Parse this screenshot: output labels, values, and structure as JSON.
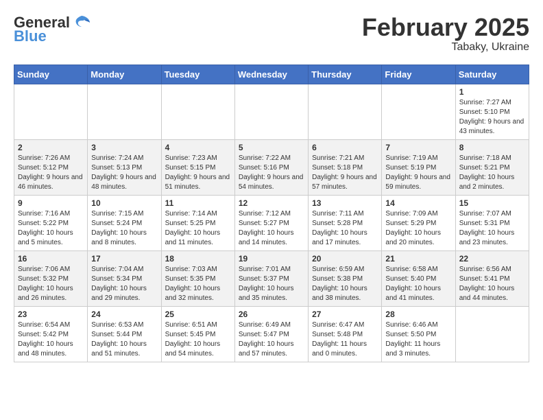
{
  "logo": {
    "general": "General",
    "blue": "Blue"
  },
  "title": "February 2025",
  "subtitle": "Tabaky, Ukraine",
  "days_of_week": [
    "Sunday",
    "Monday",
    "Tuesday",
    "Wednesday",
    "Thursday",
    "Friday",
    "Saturday"
  ],
  "weeks": [
    [
      {
        "day": "",
        "info": ""
      },
      {
        "day": "",
        "info": ""
      },
      {
        "day": "",
        "info": ""
      },
      {
        "day": "",
        "info": ""
      },
      {
        "day": "",
        "info": ""
      },
      {
        "day": "",
        "info": ""
      },
      {
        "day": "1",
        "info": "Sunrise: 7:27 AM\nSunset: 5:10 PM\nDaylight: 9 hours and 43 minutes."
      }
    ],
    [
      {
        "day": "2",
        "info": "Sunrise: 7:26 AM\nSunset: 5:12 PM\nDaylight: 9 hours and 46 minutes."
      },
      {
        "day": "3",
        "info": "Sunrise: 7:24 AM\nSunset: 5:13 PM\nDaylight: 9 hours and 48 minutes."
      },
      {
        "day": "4",
        "info": "Sunrise: 7:23 AM\nSunset: 5:15 PM\nDaylight: 9 hours and 51 minutes."
      },
      {
        "day": "5",
        "info": "Sunrise: 7:22 AM\nSunset: 5:16 PM\nDaylight: 9 hours and 54 minutes."
      },
      {
        "day": "6",
        "info": "Sunrise: 7:21 AM\nSunset: 5:18 PM\nDaylight: 9 hours and 57 minutes."
      },
      {
        "day": "7",
        "info": "Sunrise: 7:19 AM\nSunset: 5:19 PM\nDaylight: 9 hours and 59 minutes."
      },
      {
        "day": "8",
        "info": "Sunrise: 7:18 AM\nSunset: 5:21 PM\nDaylight: 10 hours and 2 minutes."
      }
    ],
    [
      {
        "day": "9",
        "info": "Sunrise: 7:16 AM\nSunset: 5:22 PM\nDaylight: 10 hours and 5 minutes."
      },
      {
        "day": "10",
        "info": "Sunrise: 7:15 AM\nSunset: 5:24 PM\nDaylight: 10 hours and 8 minutes."
      },
      {
        "day": "11",
        "info": "Sunrise: 7:14 AM\nSunset: 5:25 PM\nDaylight: 10 hours and 11 minutes."
      },
      {
        "day": "12",
        "info": "Sunrise: 7:12 AM\nSunset: 5:27 PM\nDaylight: 10 hours and 14 minutes."
      },
      {
        "day": "13",
        "info": "Sunrise: 7:11 AM\nSunset: 5:28 PM\nDaylight: 10 hours and 17 minutes."
      },
      {
        "day": "14",
        "info": "Sunrise: 7:09 AM\nSunset: 5:29 PM\nDaylight: 10 hours and 20 minutes."
      },
      {
        "day": "15",
        "info": "Sunrise: 7:07 AM\nSunset: 5:31 PM\nDaylight: 10 hours and 23 minutes."
      }
    ],
    [
      {
        "day": "16",
        "info": "Sunrise: 7:06 AM\nSunset: 5:32 PM\nDaylight: 10 hours and 26 minutes."
      },
      {
        "day": "17",
        "info": "Sunrise: 7:04 AM\nSunset: 5:34 PM\nDaylight: 10 hours and 29 minutes."
      },
      {
        "day": "18",
        "info": "Sunrise: 7:03 AM\nSunset: 5:35 PM\nDaylight: 10 hours and 32 minutes."
      },
      {
        "day": "19",
        "info": "Sunrise: 7:01 AM\nSunset: 5:37 PM\nDaylight: 10 hours and 35 minutes."
      },
      {
        "day": "20",
        "info": "Sunrise: 6:59 AM\nSunset: 5:38 PM\nDaylight: 10 hours and 38 minutes."
      },
      {
        "day": "21",
        "info": "Sunrise: 6:58 AM\nSunset: 5:40 PM\nDaylight: 10 hours and 41 minutes."
      },
      {
        "day": "22",
        "info": "Sunrise: 6:56 AM\nSunset: 5:41 PM\nDaylight: 10 hours and 44 minutes."
      }
    ],
    [
      {
        "day": "23",
        "info": "Sunrise: 6:54 AM\nSunset: 5:42 PM\nDaylight: 10 hours and 48 minutes."
      },
      {
        "day": "24",
        "info": "Sunrise: 6:53 AM\nSunset: 5:44 PM\nDaylight: 10 hours and 51 minutes."
      },
      {
        "day": "25",
        "info": "Sunrise: 6:51 AM\nSunset: 5:45 PM\nDaylight: 10 hours and 54 minutes."
      },
      {
        "day": "26",
        "info": "Sunrise: 6:49 AM\nSunset: 5:47 PM\nDaylight: 10 hours and 57 minutes."
      },
      {
        "day": "27",
        "info": "Sunrise: 6:47 AM\nSunset: 5:48 PM\nDaylight: 11 hours and 0 minutes."
      },
      {
        "day": "28",
        "info": "Sunrise: 6:46 AM\nSunset: 5:50 PM\nDaylight: 11 hours and 3 minutes."
      },
      {
        "day": "",
        "info": ""
      }
    ]
  ]
}
